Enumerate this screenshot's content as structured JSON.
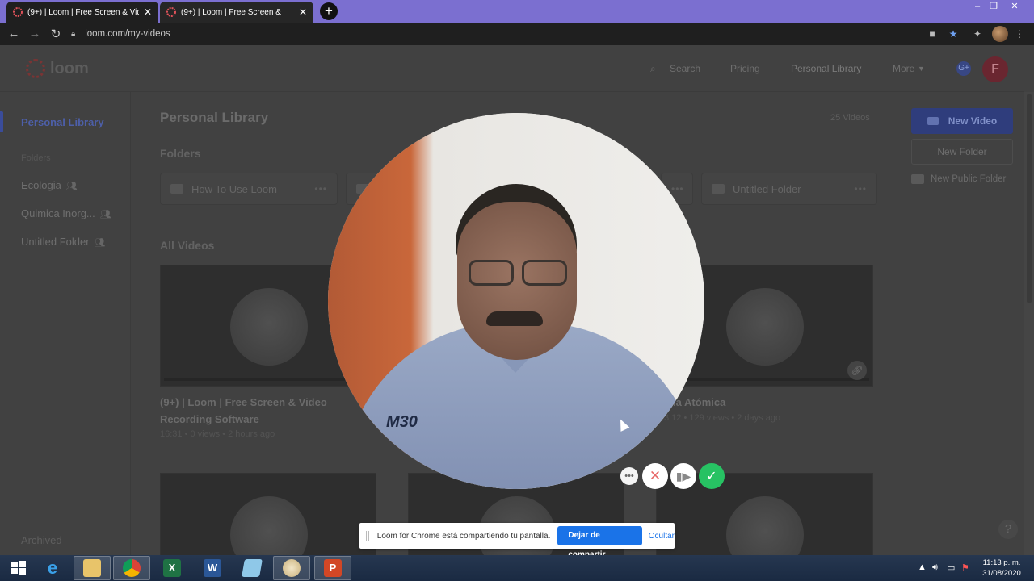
{
  "browser": {
    "tabs": [
      {
        "title": "(9+) | Loom | Free Screen & Vide",
        "active": true
      },
      {
        "title": "(9+) | Loom | Free Screen & ",
        "active": false
      }
    ],
    "new_tab": "+",
    "url": "loom.com/my-videos"
  },
  "loom": {
    "brand": "loom",
    "nav": {
      "search": "Search",
      "pricing": "Pricing",
      "personal_library": "Personal Library",
      "more": "More"
    },
    "avatar_letter": "F",
    "sidebar": {
      "personal_library": "Personal Library",
      "folders_heading": "Folders",
      "folders": [
        "Ecologia",
        "Quimica Inorg...",
        "Untitled Folder"
      ],
      "archived": "Archived"
    },
    "main": {
      "title": "Personal Library",
      "video_count": "25 Videos",
      "folders_heading": "Folders",
      "folders": [
        {
          "name": "How To Use Loom"
        },
        {
          "name": "Untitled Folder"
        }
      ],
      "all_videos_heading": "All Videos",
      "videos": [
        {
          "title": "(9+) | Loom | Free Screen & Video Recording Software",
          "meta": "16:31 • 0 views • 2 hours ago"
        },
        {
          "title": "ría Atómica",
          "meta": "3:12 • 129 views • 2 days ago"
        }
      ]
    },
    "actions": {
      "new_video": "New Video",
      "new_folder": "New Folder",
      "new_public_folder": "New Public Folder"
    },
    "help": "?"
  },
  "recording": {
    "share_message": "Loom for Chrome está compartiendo tu pantalla.",
    "stop_sharing": "Dejar de compartir",
    "hide": "Ocultar",
    "shirt_logo": "M30"
  },
  "taskbar": {
    "apps": [
      "windows-start",
      "internet-explorer",
      "file-explorer",
      "chrome",
      "excel",
      "word",
      "notepad",
      "paint",
      "powerpoint"
    ],
    "time": "11:13 p. m.",
    "date": "31/08/2020"
  },
  "colors": {
    "loom_blue": "#625df5",
    "record_green": "#27c263",
    "tab_strip": "#7b6fd0"
  }
}
